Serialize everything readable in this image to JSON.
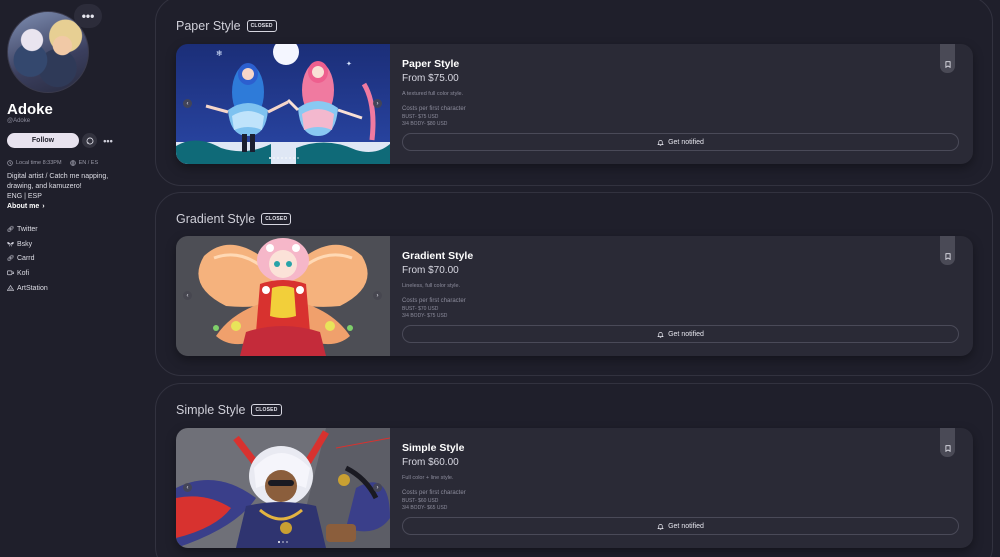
{
  "profile": {
    "display_name": "Adoke",
    "handle": "@Adoke",
    "follow_label": "Follow",
    "local_time": "Local time 8:33PM",
    "languages": "EN / ES",
    "bio_lines": [
      "Digital artist / Catch me napping,",
      "drawing, and kamuzero!",
      "ENG | ESP"
    ],
    "about_me_label": "About me",
    "links": [
      {
        "label": "Twitter",
        "icon": "link-icon"
      },
      {
        "label": "Bsky",
        "icon": "butterfly-icon"
      },
      {
        "label": "Carrd",
        "icon": "link-icon"
      },
      {
        "label": "Kofi",
        "icon": "cup-icon"
      },
      {
        "label": "ArtStation",
        "icon": "artstation-icon"
      }
    ]
  },
  "sections": [
    {
      "title": "Paper Style",
      "badge": "CLOSED",
      "card": {
        "title": "Paper Style",
        "price": "From $75.00",
        "description": "A textured full color style.",
        "cost_title": "Costs per first character",
        "cost_lines": [
          "BUST- $75 USD",
          "3/4 BODY- $80 USD"
        ],
        "notify_label": "Get notified"
      }
    },
    {
      "title": "Gradient Style",
      "badge": "CLOSED",
      "card": {
        "title": "Gradient Style",
        "price": "From $70.00",
        "description": "Lineless, full color style.",
        "cost_title": "Costs per first character",
        "cost_lines": [
          "BUST- $70 USD",
          "3/4 BODY- $75 USD"
        ],
        "notify_label": "Get notified"
      }
    },
    {
      "title": "Simple Style",
      "badge": "CLOSED",
      "card": {
        "title": "Simple Style",
        "price": "From $60.00",
        "description": "Full color + line style.",
        "cost_title": "Costs per first character",
        "cost_lines": [
          "BUST- $60 USD",
          "3/4 BODY- $65 USD"
        ],
        "notify_label": "Get notified"
      }
    }
  ],
  "icons": {
    "more": "more-horizontal-icon",
    "chat": "chat-icon",
    "clock": "clock-icon",
    "globe": "globe-icon",
    "chevron": "chevron-right-icon",
    "bell": "bell-icon",
    "bookmark": "bookmark-icon",
    "carousel_prev": "chevron-left-icon",
    "carousel_next": "chevron-right-icon"
  },
  "colors": {
    "background": "#1f1f2b",
    "card": "#2a2a36",
    "follow_button": "#e7e2ee"
  }
}
